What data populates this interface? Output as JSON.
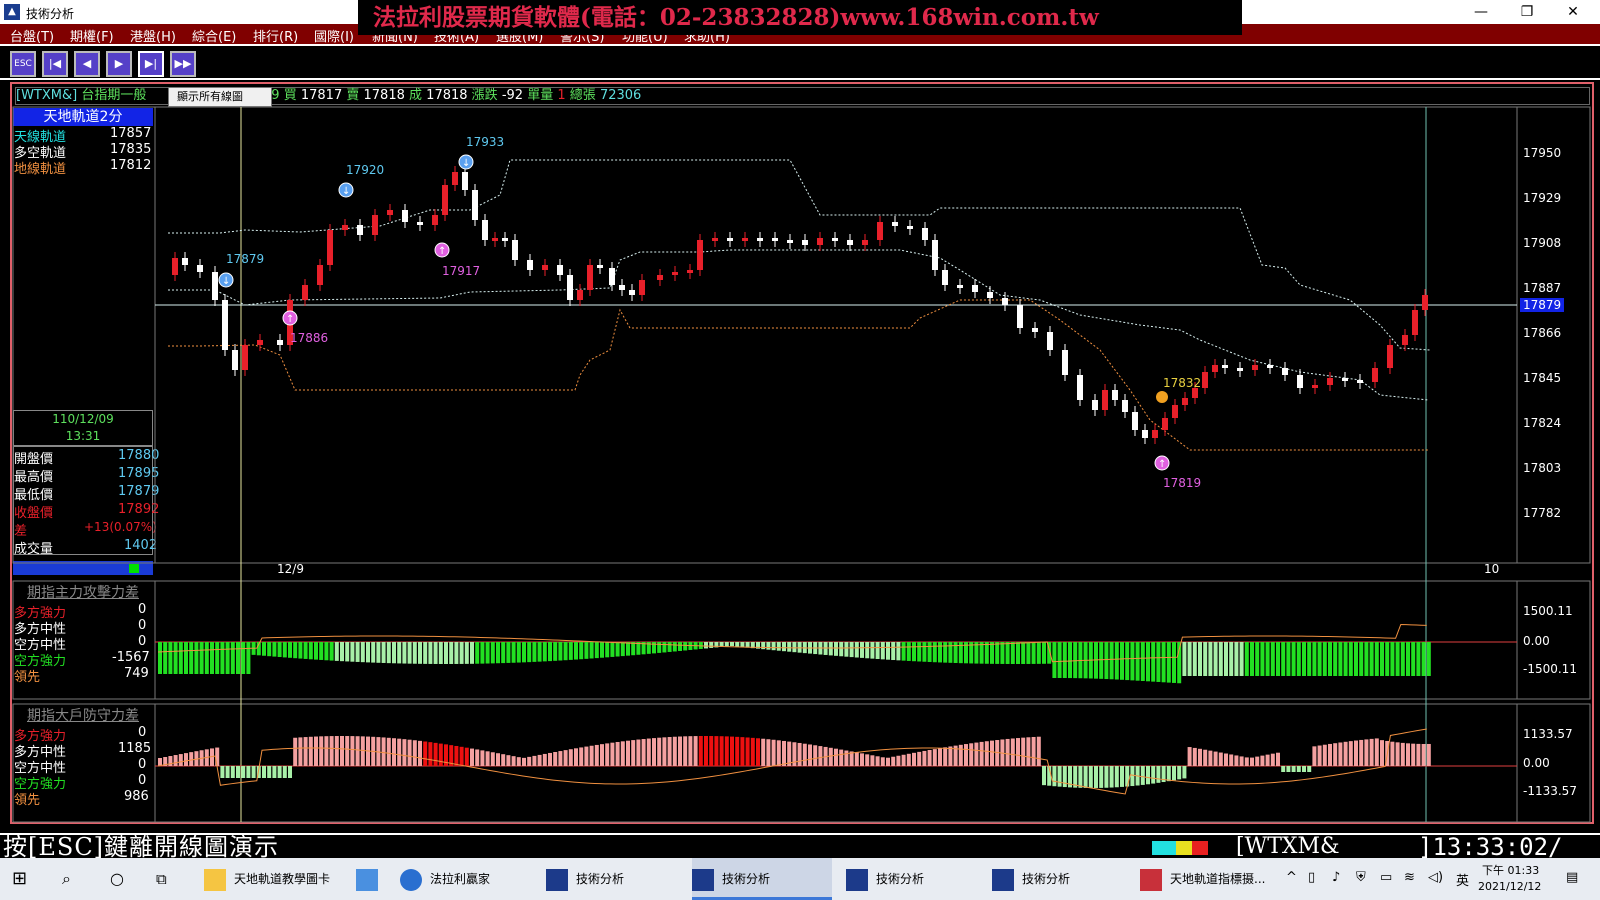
{
  "window": {
    "title": "技術分析",
    "banner": "法拉利股票期貨軟體(電話：02-23832828)www.168win.com.tw"
  },
  "menu": {
    "items": [
      "台盤(T)",
      "期權(F)",
      "港盤(H)",
      "綜合(E)",
      "排行(R)",
      "國際(I)",
      "新聞(N)",
      "技術(A)",
      "選股(M)",
      "警示(S)",
      "功能(U)",
      "求助(H)"
    ]
  },
  "toolbar": {
    "esc_label": "ESC",
    "tooltip": "顯示所有線圖"
  },
  "quote": {
    "symbol": "[WTXM&]",
    "name": "台指期一般",
    "time": ":59",
    "buy_label": "買",
    "buy": "17817",
    "sell_label": "賣",
    "sell": "17818",
    "deal_label": "成",
    "deal": "17818",
    "change_label": "漲跌",
    "change": "-92",
    "vol_label": "單量",
    "vol": "1",
    "total_label": "總張",
    "total": "72306"
  },
  "indicator": {
    "title": "天地軌道2分",
    "rows": [
      {
        "label": "天線軌道",
        "value": "17857"
      },
      {
        "label": "多空軌道",
        "value": "17835"
      },
      {
        "label": "地線軌道",
        "value": "17812"
      }
    ]
  },
  "info": {
    "date": "110/12/09",
    "time": "13:31",
    "rows": [
      {
        "label": "開盤價",
        "value": "17880"
      },
      {
        "label": "最高價",
        "value": "17895"
      },
      {
        "label": "最低價",
        "value": "17879"
      },
      {
        "label": "收盤價",
        "value": "17892"
      },
      {
        "label": "差",
        "value": "+13(0.07%)"
      },
      {
        "label": "成交量",
        "value": "1402"
      }
    ]
  },
  "price_axis": {
    "ticks": [
      "17950",
      "17929",
      "17908",
      "17887",
      "17866",
      "17845",
      "17824",
      "17803",
      "17782"
    ],
    "current": "17879",
    "date_left": "12/9",
    "date_right": "10"
  },
  "annotations": {
    "p17879": "17879",
    "p17920": "17920",
    "p17933": "17933",
    "p17917": "17917",
    "p17886": "17886",
    "p17832": "17832",
    "p17819": "17819"
  },
  "sub1": {
    "title": "期指主力攻擊力差",
    "rows": [
      {
        "label": "多方強力",
        "value": "0"
      },
      {
        "label": "多方中性",
        "value": "0"
      },
      {
        "label": "空方中性",
        "value": "0"
      },
      {
        "label": "空方強力",
        "value": "-1567"
      },
      {
        "label": "領先",
        "value": "749"
      }
    ],
    "ticks": [
      "1500.11",
      "0.00",
      "-1500.11"
    ]
  },
  "sub2": {
    "title": "期指大戶防守力差",
    "rows": [
      {
        "label": "多方強力",
        "value": "0"
      },
      {
        "label": "多方中性",
        "value": "1185"
      },
      {
        "label": "空方中性",
        "value": "0"
      },
      {
        "label": "空方強力",
        "value": "0"
      },
      {
        "label": "領先",
        "value": "986"
      }
    ],
    "ticks": [
      "1133.57",
      "0.00",
      "-1133.57"
    ]
  },
  "status": {
    "hint": "按[ESC]鍵離開線圖演示",
    "symbol": "[WTXM&",
    "clock": "]13:33:02/"
  },
  "taskbar": {
    "items": [
      "天地軌道教學圖卡",
      "法拉利贏家",
      "技術分析",
      "技術分析",
      "技術分析",
      "技術分析",
      "天地軌道指標摄..."
    ],
    "ime": "英",
    "time": "下午 01:33",
    "date": "2021/12/12"
  },
  "colors": {
    "up": "#e8202a",
    "down": "#ffffff",
    "upper_band": "#d8f0f0",
    "lower_band": "#f09040",
    "green_bar": "#22e022",
    "light_green_bar": "#a8f0a8",
    "pink_bar": "#f4a0a0",
    "red_bar": "#ee1010",
    "label_blue": "#5fc9f0",
    "label_pink": "#e060e0"
  }
}
